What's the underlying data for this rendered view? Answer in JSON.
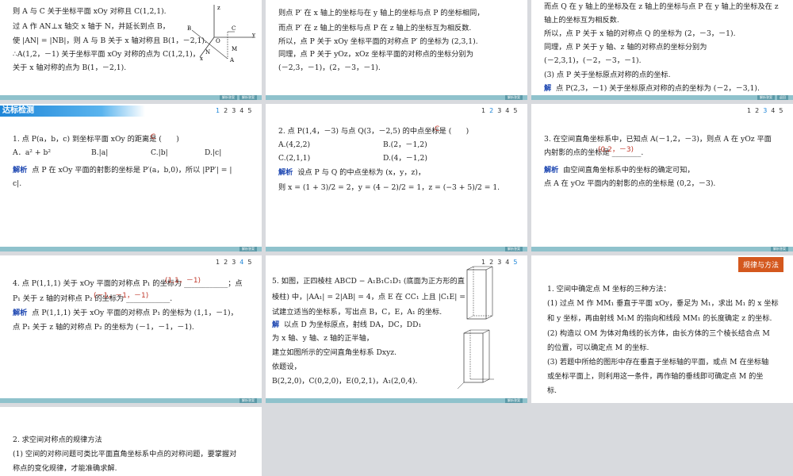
{
  "slide1": {
    "lines": [
      "则 A 与 C 关于坐标平面 xOy 对称且 C(1,2,1).",
      "过 A 作 AN⊥x 轴交 x 轴于 N，并延长到点 B，",
      "使 |AN| = |NB|，则 A 与 B 关于 x 轴对称且 B(1，－2,1).",
      "∴A(1,2，－1) 关于坐标平面 xOy 对称的点为 C(1,2,1)，",
      "关于 x 轴对称的点为 B(1，－2,1)."
    ],
    "fig_labels": [
      "z",
      "B",
      "C",
      "O",
      "y",
      "M",
      "N",
      "x",
      "A"
    ]
  },
  "slide2": {
    "lines": [
      "则点 P′ 在 x 轴上的坐标与在 y 轴上的坐标与点 P 的坐标相同，",
      "而点 P′ 在 z 轴上的坐标与点 P 在 z 轴上的坐标互为相反数.",
      "所以，点 P 关于 xOy 坐标平面的对称点 P′ 的坐标为 (2,3,1).",
      "同理，点 P 关于 yOz，xOz 坐标平面的对称点的坐标分别为",
      "(－2,3，－1)，(2，－3，－1)."
    ]
  },
  "slide3": {
    "lines": [
      "而点 Q 在 y 轴上的坐标及在 z 轴上的坐标与点 P 在 y 轴上的坐标及在 z",
      "轴上的坐标互为相反数.",
      "所以，点 P 关于 x 轴的对称点 Q 的坐标为 (2，－3，－1).",
      "同理，点 P 关于 y 轴、z 轴的对称点的坐标分别为",
      "(－2,3,1)，(－2，－3，－1)."
    ],
    "q3_label": "(3) 点 P 关于坐标原点对称的点的坐标.",
    "sol_label": "解",
    "sol_text": "点 P(2,3，－1) 关于坐标原点对称的点的坐标为 (－2，－3,1)."
  },
  "slide4": {
    "tag": "达标检测",
    "pager": [
      "1",
      "2",
      "3",
      "4",
      "5"
    ],
    "q": "1. 点 P(a，b，c) 到坐标平面 xOy 的距离是 (　　)",
    "answer": "C",
    "options": [
      "A．a² + b²",
      "B.|a|",
      "C.|b|",
      "D.|c|"
    ],
    "sol_label": "解析",
    "sol_text": "点 P 在 xOy 平面的射影的坐标是 P′(a，b,0)，所以 |PP′| = |",
    "sol_text2": "c|."
  },
  "slide5": {
    "pager": [
      "1",
      "2",
      "3",
      "4",
      "5"
    ],
    "q": "2. 点 P(1,4，－3) 与点 Q(3，－2,5) 的中点坐标是 (　　)",
    "answer": "C",
    "options": [
      "A.(4,2,2)",
      "B.(2，－1,2)",
      "C.(2,1,1)",
      "D.(4，－1,2)"
    ],
    "sol_label": "解析",
    "sol_text": "设点 P 与 Q 的中点坐标为 (x，y，z)，",
    "sol_text2": "则 x = (1 + 3)/2 = 2，y = (4 − 2)/2 = 1，z = (−3 + 5)/2 = 1."
  },
  "slide6": {
    "pager": [
      "1",
      "2",
      "3",
      "4",
      "5"
    ],
    "q": "3. 在空间直角坐标系中，已知点 A(－1,2，－3)，则点 A 在 yOz 平面",
    "q2": "内射影的点的坐标是 ________.",
    "answer": "(0,2，－3)",
    "sol_label": "解析",
    "sol_text": "由空间直角坐标系中的坐标的确定可知，",
    "sol_text2": "点 A 在 yOz 平面内的射影的点的坐标是 (0,2，－3)."
  },
  "slide7": {
    "pager": [
      "1",
      "2",
      "3",
      "4",
      "5"
    ],
    "q": "4. 点 P(1,1,1) 关于 xOy 平面的对称点 P₁ 的坐标为 ____________；点",
    "q2": "P₁ 关于 z 轴的对称点 P₂ 的坐标为 ____________.",
    "answer1": "(1,1，－1)",
    "answer2": "(－1，－1，－1)",
    "sol_label": "解析",
    "sol_text": "点 P(1,1,1) 关于 xOy 平面的对称点 P₁ 的坐标为 (1,1，－1)，",
    "sol_text2": "点 P₁ 关于 z 轴的对称点 P₂ 的坐标为 (－1，－1，－1)."
  },
  "slide8": {
    "pager": [
      "1",
      "2",
      "3",
      "4",
      "5"
    ],
    "lines": [
      "5. 如图，正四棱柱 ABCD − A₁B₁C₁D₁ (底面为正方形的直",
      "棱柱) 中，|AA₁| = 2|AB| = 4，点 E 在 CC₁ 上且 |C₁E| =",
      "试建立适当的坐标系，写出点 B，C，E，A₁ 的坐标."
    ],
    "sol_label": "解",
    "sol_lines": [
      "以点 D 为坐标原点，射线 DA，DC，DD₁",
      "为 x 轴、y 轴、z 轴的正半轴，",
      "建立如图所示的空间直角坐标系 Dxyz.",
      "依题设，",
      "B(2,2,0)，C(0,2,0)，E(0,2,1)，A₁(2,0,4)."
    ]
  },
  "slide9": {
    "button": "规律与方法",
    "lines": [
      "1. 空间中确定点 M 坐标的三种方法：",
      "(1) 过点 M 作 MM₁ 垂直于平面 xOy，垂足为 M₁，求出 M₁ 的 x 坐标",
      "和 y 坐标，再由射线 M₁M 的指向和线段 MM₁ 的长度确定 z 的坐标.",
      "(2) 构造以 OM 为体对角线的长方体，由长方体的三个棱长结合点 M",
      "的位置，可以确定点 M 的坐标.",
      "(3) 若题中所给的图形中存在垂直于坐标轴的平面，或点 M 在坐标轴",
      "或坐标平面上，则利用这一条件，再作轴的垂线即可确定点 M 的坐",
      "标."
    ]
  },
  "slide10": {
    "lines": [
      "2. 求空间对称点的规律方法",
      "(1) 空间的对称问题可类比平面直角坐标系中点的对称问题，要掌握对",
      "称点的变化规律，才能准确求解."
    ]
  },
  "footer_labels": {
    "a": "解析答案",
    "b": "返回"
  }
}
